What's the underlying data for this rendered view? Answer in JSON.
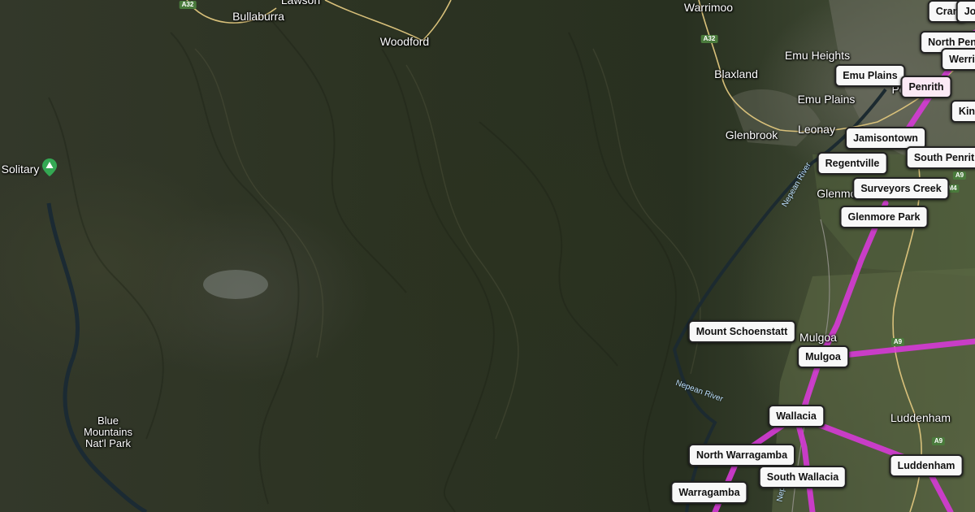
{
  "map": {
    "type": "satellite",
    "route_color": "#d63ad6",
    "highlight_fill": "#fbe9f5"
  },
  "places": [
    {
      "id": "lawson",
      "label": "Lawson"
    },
    {
      "id": "bullaburra",
      "label": "Bullaburra"
    },
    {
      "id": "woodford",
      "label": "Woodford"
    },
    {
      "id": "warrimoo",
      "label": "Warrimoo"
    },
    {
      "id": "blaxland",
      "label": "Blaxland"
    },
    {
      "id": "emu-heights",
      "label": "Emu Heights"
    },
    {
      "id": "emu-plains-town",
      "label": "Emu Plains"
    },
    {
      "id": "glenbrook",
      "label": "Glenbrook"
    },
    {
      "id": "leonay",
      "label": "Leonay"
    },
    {
      "id": "glenmore-town",
      "label": "Glenmore"
    },
    {
      "id": "mulgoa-town",
      "label": "Mulgoa"
    },
    {
      "id": "luddenham-town",
      "label": "Luddenham"
    },
    {
      "id": "pe",
      "label": "Pe"
    },
    {
      "id": "solitary",
      "label": "Solitary"
    }
  ],
  "park_label": [
    "Blue",
    "Mountains",
    "Nat'l Park"
  ],
  "road_shields": [
    "A32",
    "A32",
    "A9",
    "A9",
    "A9",
    "M4"
  ],
  "rivers": [
    "Nepean River",
    "Nepean River",
    "Nepe"
  ],
  "suburbs": [
    {
      "id": "cran",
      "label": "Cran",
      "highlight": false
    },
    {
      "id": "jo",
      "label": "Jo",
      "highlight": false
    },
    {
      "id": "north-penrith",
      "label": "North Pen",
      "highlight": false
    },
    {
      "id": "werrington",
      "label": "Werri",
      "highlight": false
    },
    {
      "id": "emu-plains",
      "label": "Emu Plains",
      "highlight": false
    },
    {
      "id": "penrith",
      "label": "Penrith",
      "highlight": true
    },
    {
      "id": "kingswood",
      "label": "Kin",
      "highlight": false
    },
    {
      "id": "jamisontown",
      "label": "Jamisontown",
      "highlight": false
    },
    {
      "id": "south-penrith",
      "label": "South Penrit",
      "highlight": false
    },
    {
      "id": "regentville",
      "label": "Regentville",
      "highlight": false
    },
    {
      "id": "surveyors-creek",
      "label": "Surveyors Creek",
      "highlight": false
    },
    {
      "id": "glenmore-park",
      "label": "Glenmore Park",
      "highlight": false
    },
    {
      "id": "mount-schoenstatt",
      "label": "Mount Schoenstatt",
      "highlight": false
    },
    {
      "id": "mulgoa",
      "label": "Mulgoa",
      "highlight": false
    },
    {
      "id": "wallacia",
      "label": "Wallacia",
      "highlight": false
    },
    {
      "id": "north-warragamba",
      "label": "North Warragamba",
      "highlight": false
    },
    {
      "id": "south-wallacia",
      "label": "South Wallacia",
      "highlight": false
    },
    {
      "id": "warragamba",
      "label": "Warragamba",
      "highlight": false
    },
    {
      "id": "luddenham",
      "label": "Luddenham",
      "highlight": false
    }
  ]
}
